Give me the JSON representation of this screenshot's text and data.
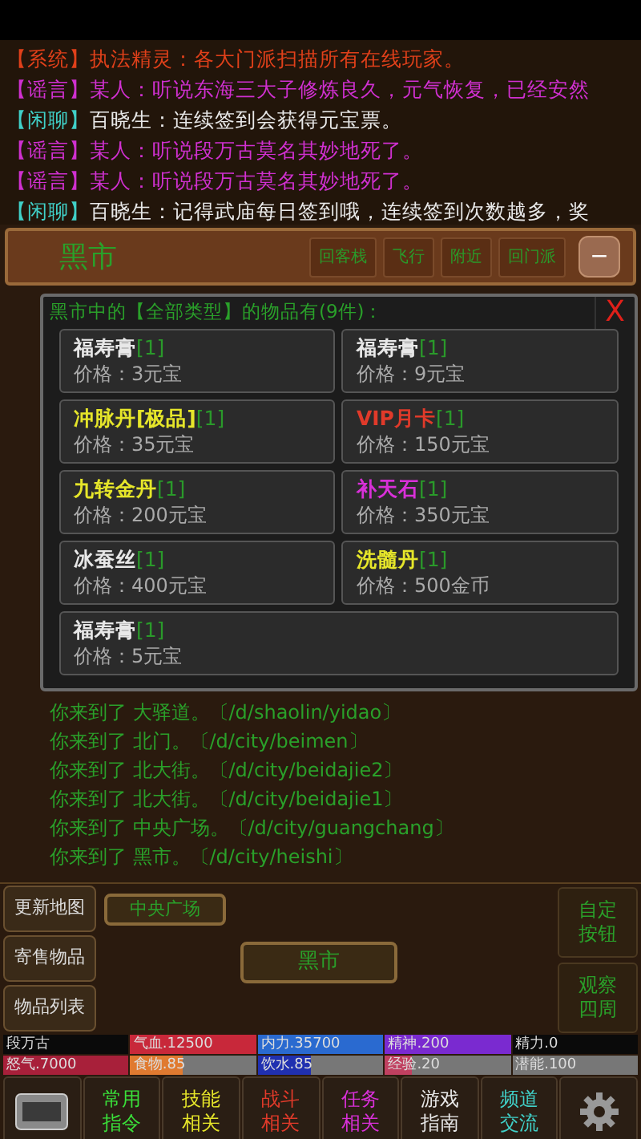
{
  "chat": [
    {
      "kind": "system",
      "channel": "【系统】",
      "text": "执法精灵：各大门派扫描所有在线玩家。"
    },
    {
      "kind": "rumor",
      "channel": "【谣言】",
      "text": "某人：听说东海三大子修炼良久，元气恢复，已经安然"
    },
    {
      "kind": "chat",
      "channel": "【闲聊】",
      "text": "百晓生：连续签到会获得元宝票。"
    },
    {
      "kind": "rumor",
      "channel": "【谣言】",
      "text": "某人：听说段万古莫名其妙地死了。"
    },
    {
      "kind": "rumor",
      "channel": "【谣言】",
      "text": "某人：听说段万古莫名其妙地死了。"
    },
    {
      "kind": "chat",
      "channel": "【闲聊】",
      "text": "百晓生：记得武庙每日签到哦，连续签到次数越多，奖"
    }
  ],
  "location_bar": {
    "title": "黑市",
    "buttons": [
      "回客栈",
      "飞行",
      "附近",
      "回门派"
    ],
    "collapse": "−"
  },
  "market": {
    "title": "黑市中的【全部类型】的物品有(9件)：",
    "close": "X",
    "items": [
      {
        "name": "福寿膏",
        "count": "[1]",
        "price": "价格：3元宝",
        "color": "#e8e8e8"
      },
      {
        "name": "福寿膏",
        "count": "[1]",
        "price": "价格：9元宝",
        "color": "#e8e8e8"
      },
      {
        "name": "冲脉丹[极品]",
        "count": "[1]",
        "price": "价格：35元宝",
        "color": "#e6e62a"
      },
      {
        "name": "VIP月卡",
        "count": "[1]",
        "price": "价格：150元宝",
        "color": "#e03a2a"
      },
      {
        "name": "九转金丹",
        "count": "[1]",
        "price": "价格：200元宝",
        "color": "#e6e62a"
      },
      {
        "name": "补天石",
        "count": "[1]",
        "price": "价格：350元宝",
        "color": "#d830d8"
      },
      {
        "name": "冰蚕丝",
        "count": "[1]",
        "price": "价格：400元宝",
        "color": "#e8e8e8"
      },
      {
        "name": "洗髓丹",
        "count": "[1]",
        "price": "价格：500金币",
        "color": "#e6e62a"
      },
      {
        "name": "福寿膏",
        "count": "[1]",
        "price": "价格：5元宝",
        "color": "#e8e8e8"
      }
    ]
  },
  "log": [
    "你来到了 大驿道。〔/d/shaolin/yidao〕",
    "你来到了 北门。〔/d/city/beimen〕",
    "你来到了 北大街。〔/d/city/beidajie2〕",
    "你来到了 北大街。〔/d/city/beidajie1〕",
    "你来到了 中央广场。〔/d/city/guangchang〕",
    "你来到了 黑市。〔/d/city/heishi〕"
  ],
  "side_buttons": [
    "更新地图",
    "寄售物品",
    "物品列表"
  ],
  "map": {
    "rooms": [
      {
        "label": "中央广场",
        "selected": false
      },
      {
        "label": "黑市",
        "selected": true
      }
    ]
  },
  "right_buttons": [
    [
      "自定",
      "按钮"
    ],
    [
      "观察",
      "四周"
    ]
  ],
  "stats": [
    {
      "text": "段万古",
      "level": 1,
      "color": "#0a0a0a"
    },
    {
      "text": "气血.12500",
      "level": 1,
      "color": "#c8283a"
    },
    {
      "text": "内力.35700",
      "level": 1,
      "color": "#2a6ad0"
    },
    {
      "text": "精神.200",
      "level": 1,
      "color": "#7a2ad0"
    },
    {
      "text": "精力.0",
      "level": 1,
      "color": "#0a0a0a"
    },
    {
      "text": "怒气.7000",
      "level": 1,
      "color": "#a8203a"
    },
    {
      "text": "食物.85",
      "level": 0.42,
      "color": "#e07a30"
    },
    {
      "text": "饮水.85",
      "level": 0.42,
      "color": "#2030b0"
    },
    {
      "text": "经验.20",
      "level": 0.22,
      "color": "#c04060"
    },
    {
      "text": "潜能.100"
    }
  ],
  "menu": [
    {
      "kind": "input"
    },
    {
      "kind": "text",
      "lines": [
        "常用",
        "指令"
      ],
      "color": "#3ae03a"
    },
    {
      "kind": "text",
      "lines": [
        "技能",
        "相关"
      ],
      "color": "#e6e62a"
    },
    {
      "kind": "text",
      "lines": [
        "战斗",
        "相关"
      ],
      "color": "#e03a2a"
    },
    {
      "kind": "text",
      "lines": [
        "任务",
        "相关"
      ],
      "color": "#d830d8"
    },
    {
      "kind": "text",
      "lines": [
        "游戏",
        "指南"
      ],
      "color": "#e8e8e8"
    },
    {
      "kind": "text",
      "lines": [
        "频道",
        "交流"
      ],
      "color": "#40d0c8"
    },
    {
      "kind": "settings"
    }
  ]
}
